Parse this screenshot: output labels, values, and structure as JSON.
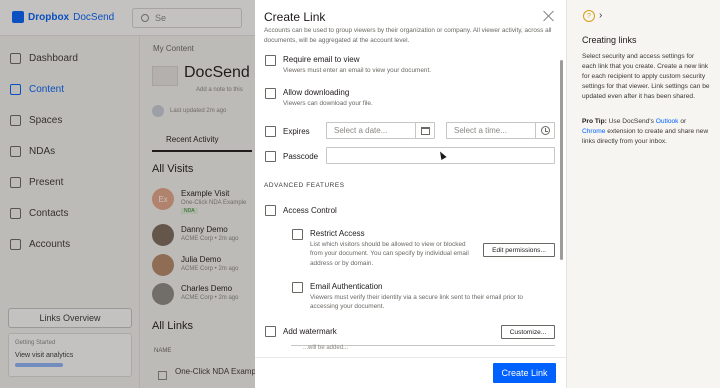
{
  "app": {
    "brand": "Dropbox",
    "product": "DocSend",
    "search_placeholder": "Se",
    "nav": [
      {
        "label": "Dashboard",
        "icon": "dashboard-icon"
      },
      {
        "label": "Content",
        "icon": "content-icon",
        "active": true
      },
      {
        "label": "Spaces",
        "icon": "spaces-icon"
      },
      {
        "label": "NDAs",
        "icon": "nda-icon"
      },
      {
        "label": "Present",
        "icon": "present-icon"
      },
      {
        "label": "Contacts",
        "icon": "contacts-icon"
      },
      {
        "label": "Accounts",
        "icon": "accounts-icon"
      }
    ],
    "links_overview": "Links Overview",
    "getting_started": {
      "label": "Getting Started",
      "title": "View visit analytics",
      "progress": 0.4
    },
    "main": {
      "breadcrumb": "My Content",
      "doc_title": "DocSend",
      "doc_note": "Add a note to this",
      "updated": "Last updated 2m ago",
      "tab_recent": "Recent Activity",
      "all_visits": "All Visits",
      "visitors": [
        {
          "name": "Example Visit",
          "sub": "One-Click NDA Example",
          "badge": "NDA",
          "initials": "Ex"
        },
        {
          "name": "Danny Demo",
          "sub": "ACME Corp • 2m ago"
        },
        {
          "name": "Julia Demo",
          "sub": "ACME Corp • 2m ago"
        },
        {
          "name": "Charles Demo",
          "sub": "ACME Corp • 2m ago"
        }
      ],
      "all_links": "All Links",
      "name_col": "NAME",
      "row_label": "One-Click NDA Examp"
    }
  },
  "modal": {
    "title": "Create Link",
    "description": "Accounts can be used to group viewers by their organization or company. All viewer activity, across all documents, will be aggregated at the account level.",
    "require_email": {
      "label": "Require email to view",
      "hint": "Viewers must enter an email to view your document."
    },
    "allow_downloading": {
      "label": "Allow downloading",
      "hint": "Viewers can download your file."
    },
    "expires": {
      "label": "Expires",
      "date_placeholder": "Select a date...",
      "time_placeholder": "Select a time..."
    },
    "passcode": {
      "label": "Passcode"
    },
    "advanced_heading": "ADVANCED FEATURES",
    "access_control": {
      "label": "Access Control"
    },
    "restrict_access": {
      "label": "Restrict Access",
      "hint": "List which visitors should be allowed to view or blocked from your document. You can specify by individual email address or by domain.",
      "button": "Edit permissions..."
    },
    "email_auth": {
      "label": "Email Authentication",
      "hint": "Viewers must verify their identity via a secure link sent to their email prior to accessing your document."
    },
    "watermark": {
      "label": "Add watermark",
      "button": "Customize..."
    },
    "cut_text": "...will be added...",
    "create_button": "Create Link"
  },
  "help": {
    "title": "Creating links",
    "body": "Select security and access settings for each link that you create. Create a new link for each recipient to apply custom security settings for that viewer. Link settings can be updated even after it has been shared.",
    "tip_label": "Pro Tip:",
    "tip_pre": "Use DocSend's",
    "tip_link1": "Outlook",
    "tip_or": "or",
    "tip_link2": "Chrome",
    "tip_post": "extension to create and share new links directly from your inbox."
  }
}
